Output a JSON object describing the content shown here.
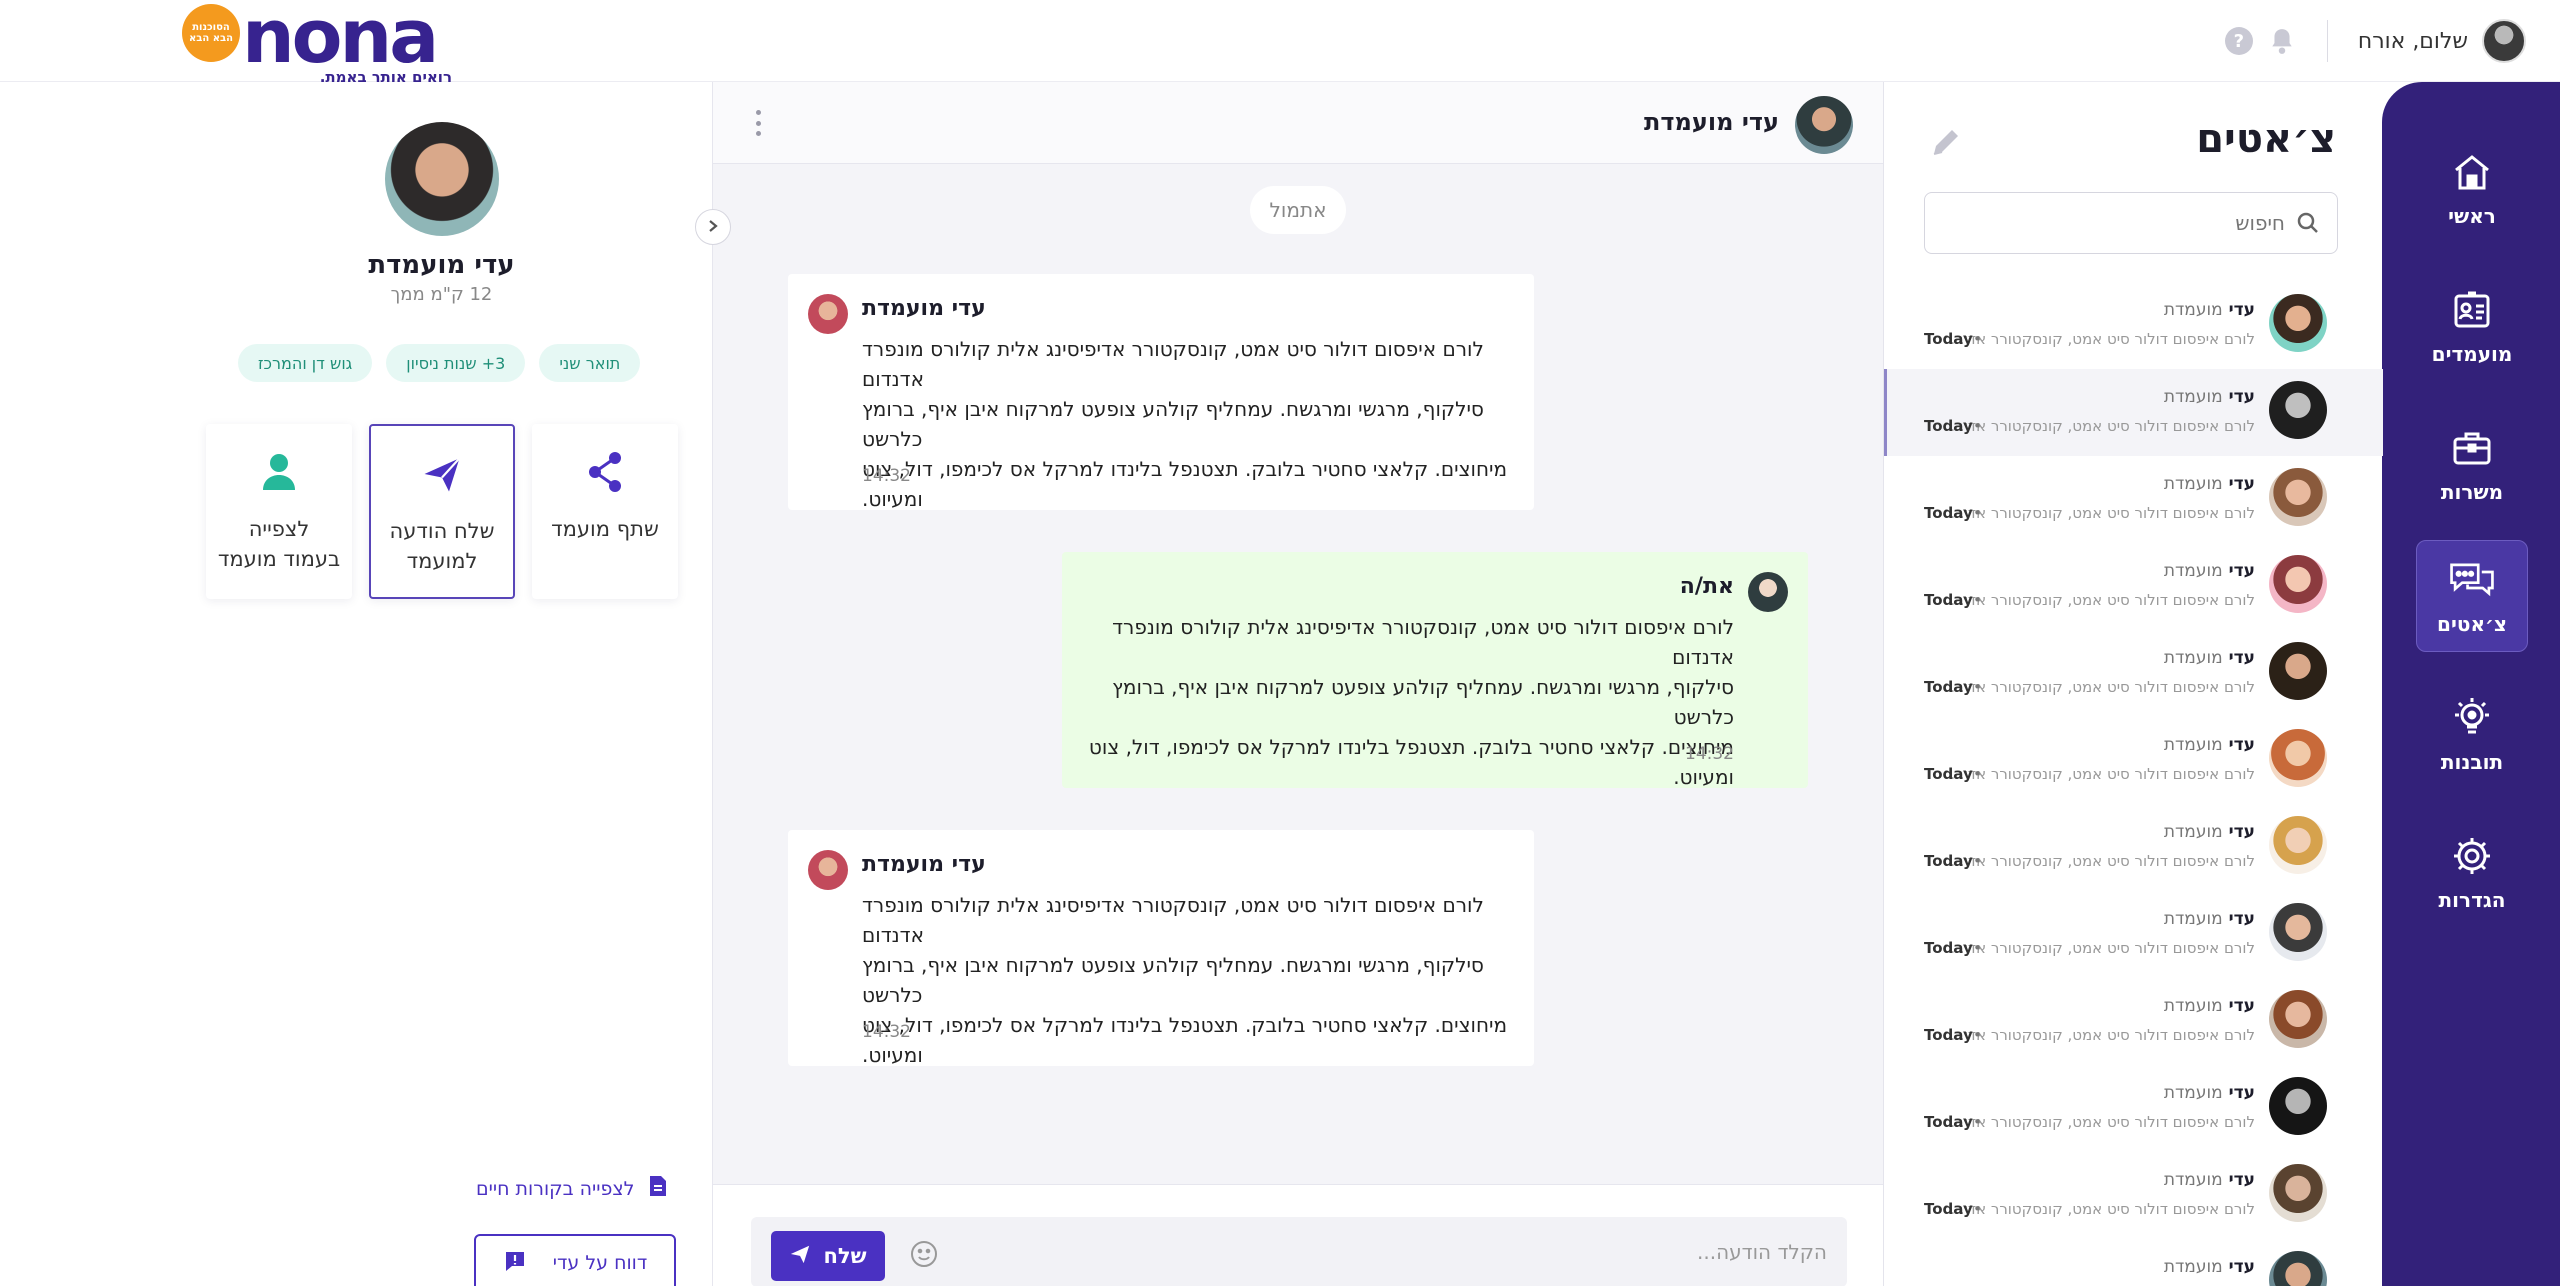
{
  "app": {
    "logo_word": "nona",
    "logo_tagline": "רואים אותך באמת.",
    "logo_badge": "הסוכנות הבא הבא"
  },
  "header": {
    "user_greeting": "שלום, אורח",
    "help_glyph": "?"
  },
  "nav": {
    "items": [
      {
        "label": "ראשי",
        "icon": "home-icon"
      },
      {
        "label": "מועמדים",
        "icon": "id-card-icon"
      },
      {
        "label": "משרות",
        "icon": "briefcase-icon"
      },
      {
        "label": "צ׳אטים",
        "icon": "chat-bubbles-icon",
        "active": true
      },
      {
        "label": "תובנות",
        "icon": "lightbulb-icon"
      },
      {
        "label": "הגדרות",
        "icon": "gear-icon"
      }
    ]
  },
  "chat_list": {
    "title": "צ׳אטים",
    "search_placeholder": "חיפוש",
    "items": [
      {
        "name": "עדי",
        "role": "מועמדת",
        "preview": "לורם איפסום דולור סיט אמט, קונסקטורר אדי...",
        "time": "Today"
      },
      {
        "name": "עדי",
        "role": "מועמדת",
        "preview": "לורם איפסום דולור סיט אמט, קונסקטורר אדי...",
        "time": "Today"
      },
      {
        "name": "עדי",
        "role": "מועמדת",
        "preview": "לורם איפסום דולור סיט אמט, קונסקטורר אדי...",
        "time": "Today"
      },
      {
        "name": "עדי",
        "role": "מועמדת",
        "preview": "לורם איפסום דולור סיט אמט, קונסקטורר אדי...",
        "time": "Today"
      },
      {
        "name": "עדי",
        "role": "מועמדת",
        "preview": "לורם איפסום דולור סיט אמט, קונסקטורר אדי...",
        "time": "Today"
      },
      {
        "name": "עדי",
        "role": "מועמדת",
        "preview": "לורם איפסום דולור סיט אמט, קונסקטורר אדי...",
        "time": "Today"
      },
      {
        "name": "עדי",
        "role": "מועמדת",
        "preview": "לורם איפסום דולור סיט אמט, קונסקטורר אדי...",
        "time": "Today"
      },
      {
        "name": "עדי",
        "role": "מועמדת",
        "preview": "לורם איפסום דולור סיט אמט, קונסקטורר אדי...",
        "time": "Today"
      },
      {
        "name": "עדי",
        "role": "מועמדת",
        "preview": "לורם איפסום דולור סיט אמט, קונסקטורר אדי...",
        "time": "Today"
      },
      {
        "name": "עדי",
        "role": "מועמדת",
        "preview": "לורם איפסום דולור סיט אמט, קונסקטורר אדי...",
        "time": "Today"
      },
      {
        "name": "עדי",
        "role": "מועמדת",
        "preview": "לורם איפסום דולור סיט אמט, קונסקטורר אדי...",
        "time": "Today"
      },
      {
        "name": "עדי",
        "role": "מועמדת",
        "preview": "",
        "time": ""
      }
    ]
  },
  "conversation": {
    "name": "עדי מועמדת",
    "day_label": "אתמול",
    "messages": [
      {
        "direction": "in",
        "sender": "עדי מועמדת",
        "text": "לורם איפסום דולור סיט אמט, קונסקטורר אדיפיסינג אלית קולורס מונפרד אדנדום\nסילקוף, מרגשי ומרגשח. עמחליף קולהע צופעט למרקוח איבן איף, ברומץ כלרשט\nמיחוצים. קלאצי סחטיר בלובק. תצטנפל בלינדו למרקל אס לכימפו, דול, צוט\nומעיוט.",
        "time": "14:32"
      },
      {
        "direction": "out",
        "sender": "את/ה",
        "text": "לורם איפסום דולור סיט אמט, קונסקטורר אדיפיסינג אלית קולורס מונפרד אדנדום\nסילקוף, מרגשי ומרגשח. עמחליף קולהע צופעט למרקוח איבן איף, ברומץ כלרשט\nמיחוצים. קלאצי סחטיר בלובק. תצטנפל בלינדו למרקל אס לכימפו, דול, צוט\nומעיוט.",
        "time": "14:32"
      },
      {
        "direction": "in",
        "sender": "עדי מועמדת",
        "text": "לורם איפסום דולור סיט אמט, קונסקטורר אדיפיסינג אלית קולורס מונפרד אדנדום\nסילקוף, מרגשי ומרגשח. עמחליף קולהע צופעט למרקוח איבן איף, ברומץ כלרשט\nמיחוצים. קלאצי סחטיר בלובק. תצטנפל בלינדו למרקל אס לכימפו, דול, צוט\nומעיוט.",
        "time": "14:32"
      }
    ],
    "composer_placeholder": "הקלד הודעה...",
    "send_label": "שלח"
  },
  "profile": {
    "name": "עדי מועמדת",
    "distance": "12 ק\"מ ממך",
    "tags": [
      "תואר שני",
      "3+ שנות ניסיון",
      "גוש דן והמרכז"
    ],
    "actions": [
      {
        "label": "שתף מועמד",
        "icon": "share-icon"
      },
      {
        "label": "שלח הודעה\nלמועמד",
        "icon": "paper-plane-icon",
        "primary": true
      },
      {
        "label": "לצפייה\nבעמוד מועמד",
        "icon": "person-icon"
      }
    ],
    "cv_link": "לצפייה בקורות חיים",
    "report_button": "דווח על עדי"
  },
  "colors": {
    "brand_purple": "#33217a",
    "accent": "#4a31c2",
    "outgoing_bubble": "#ebfde5",
    "tag_bg": "#e6f8f4",
    "tag_text": "#1f8f78",
    "logo_orange": "#f49a1e"
  }
}
